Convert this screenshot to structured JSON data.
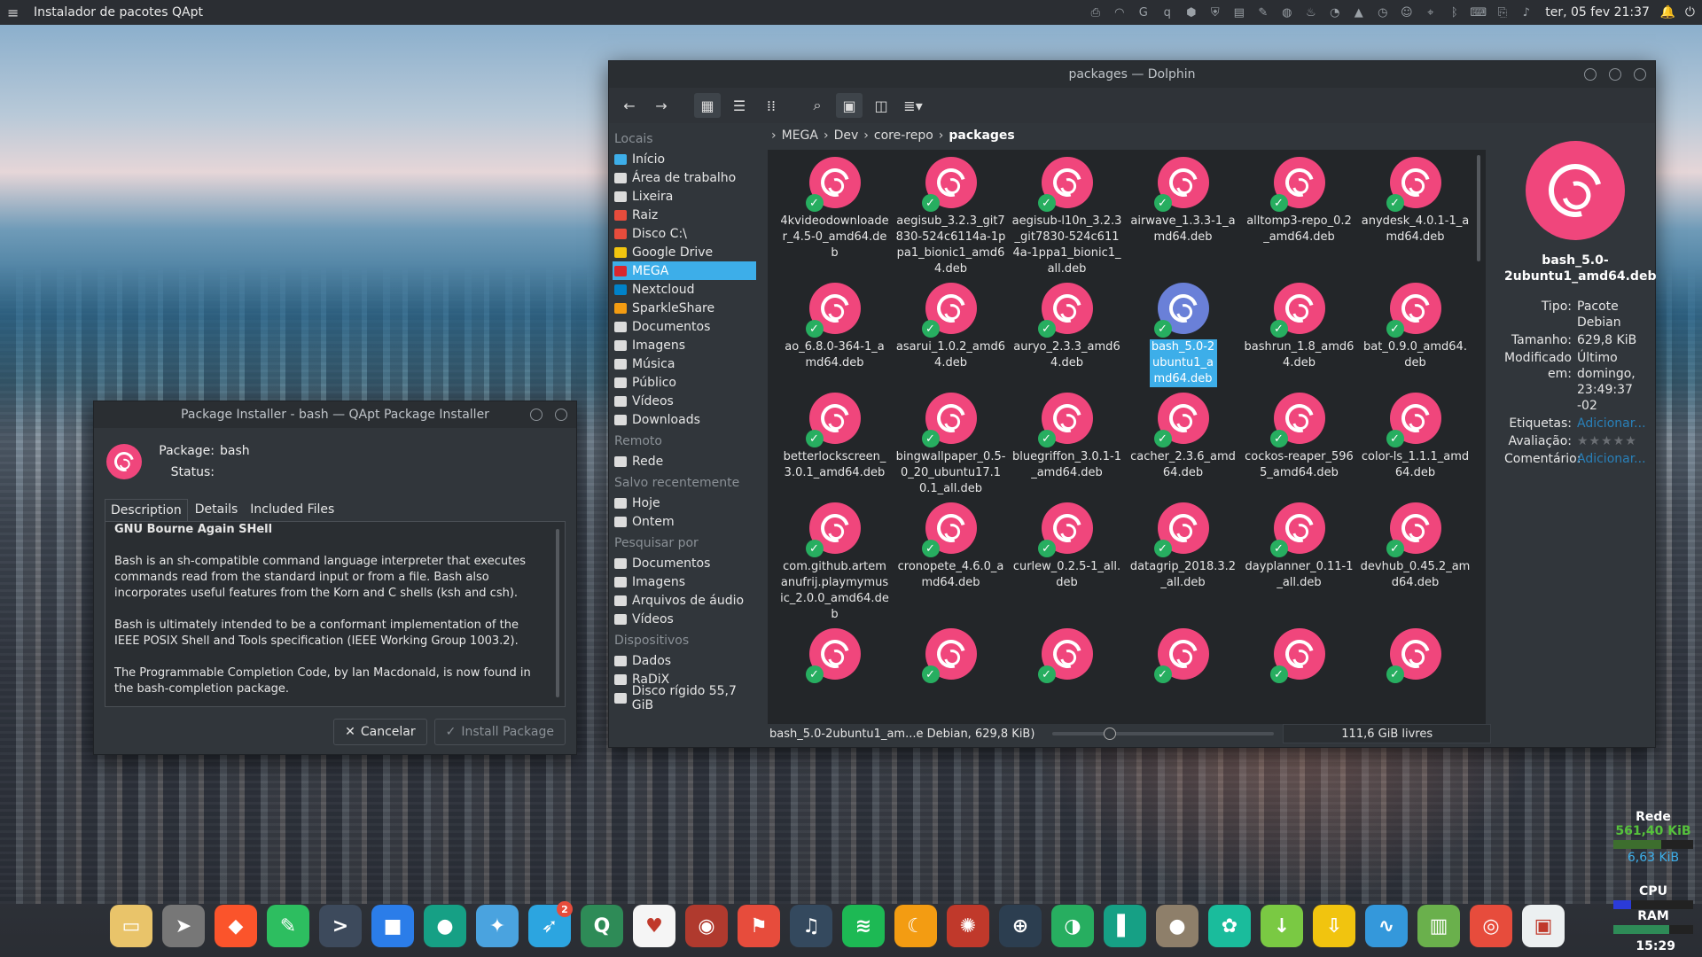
{
  "top_panel": {
    "app_title": "Instalador de pacotes QApt",
    "clock": "ter, 05 fev 21:37",
    "tray_icons": [
      "printer-icon",
      "wifi-icon",
      "g-icon",
      "qb-icon",
      "hex-icon",
      "shield-icon",
      "doc-icon",
      "pen-icon",
      "globe-icon",
      "fire-icon",
      "chat-icon",
      "drive-icon",
      "clock-icon",
      "face-icon",
      "pin-icon",
      "bluetooth-icon",
      "keyboard-icon",
      "clip-icon",
      "volume-icon"
    ]
  },
  "dolphin": {
    "title": "packages — Dolphin",
    "breadcrumb": [
      "MEGA",
      "Dev",
      "core-repo",
      "packages"
    ],
    "places": {
      "locais_label": "Locais",
      "locais": [
        "Início",
        "Área de trabalho",
        "Lixeira",
        "Raiz",
        "Disco C:\\",
        "Google Drive",
        "MEGA",
        "Nextcloud",
        "SparkleShare",
        "Documentos",
        "Imagens",
        "Música",
        "Público",
        "Vídeos",
        "Downloads"
      ],
      "remoto_label": "Remoto",
      "remoto": [
        "Rede"
      ],
      "recente_label": "Salvo recentemente",
      "recente": [
        "Hoje",
        "Ontem"
      ],
      "pesquisar_label": "Pesquisar por",
      "pesquisar": [
        "Documentos",
        "Imagens",
        "Arquivos de áudio",
        "Vídeos"
      ],
      "dispositivos_label": "Dispositivos",
      "dispositivos": [
        "Dados",
        "RaDiX",
        "Disco rígido 55,7 GiB"
      ]
    },
    "files": [
      "4kvideodownloader_4.5-0_amd64.deb",
      "aegisub_3.2.3_git7830-524c6114a-1ppa1_bionic1_amd64.deb",
      "aegisub-l10n_3.2.3_git7830-524c6114a-1ppa1_bionic1_all.deb",
      "airwave_1.3.3-1_amd64.deb",
      "alltomp3-repo_0.2_amd64.deb",
      "anydesk_4.0.1-1_amd64.deb",
      "ao_6.8.0-364-1_amd64.deb",
      "asarui_1.0.2_amd64.deb",
      "auryo_2.3.3_amd64.deb",
      "bash_5.0-2ubuntu1_amd64.deb",
      "bashrun_1.8_amd64.deb",
      "bat_0.9.0_amd64.deb",
      "betterlockscreen_3.0.1_amd64.deb",
      "bingwallpaper_0.5-0_20_ubuntu17.10.1_all.deb",
      "bluegriffon_3.0.1-1_amd64.deb",
      "cacher_2.3.6_amd64.deb",
      "cockos-reaper_5965_amd64.deb",
      "color-ls_1.1.1_amd64.deb",
      "com.github.artemanufrij.playmymusic_2.0.0_amd64.deb",
      "cronopete_4.6.0_amd64.deb",
      "curlew_0.2.5-1_all.deb",
      "datagrip_2018.3.2_all.deb",
      "dayplanner_0.11-1_all.deb",
      "devhub_0.45.2_amd64.deb",
      "",
      "",
      "",
      "",
      "",
      ""
    ],
    "selected_index": 9,
    "status_text": "bash_5.0-2ubuntu1_am...e Debian, 629,8 KiB)",
    "free_space": "111,6 GiB livres",
    "info": {
      "title": "bash_5.0-2ubuntu1_amd64.deb",
      "tipo_k": "Tipo:",
      "tipo_v": "Pacote Debian",
      "tamanho_k": "Tamanho:",
      "tamanho_v": "629,8 KiB",
      "modificado_k": "Modificado em:",
      "modificado_v": "Último domingo, 23:49:37 -02",
      "etiquetas_k": "Etiquetas:",
      "etiquetas_v": "Adicionar...",
      "avaliacao_k": "Avaliação:",
      "avaliacao_v": "★★★★★",
      "comentario_k": "Comentário:",
      "comentario_v": "Adicionar..."
    }
  },
  "qapt": {
    "title": "Package Installer - bash — QApt Package Installer",
    "package_label": "Package:",
    "package_value": "bash",
    "status_label": "Status:",
    "status_value": "",
    "tabs": [
      "Description",
      "Details",
      "Included Files"
    ],
    "desc_title": "GNU Bourne Again SHell",
    "desc_paragraphs": [
      "Bash is an sh-compatible command language interpreter that executes commands read from the standard input or from a file. Bash also incorporates useful features from the Korn and C shells (ksh and csh).",
      "Bash is ultimately intended to be a conformant implementation of the IEEE POSIX Shell and Tools specification (IEEE Working Group 1003.2).",
      "The Programmable Completion Code, by Ian Macdonald, is now found in the bash-completion package."
    ],
    "cancel_label": "Cancelar",
    "install_label": "Install Package"
  },
  "monitors": {
    "rede_label": "Rede",
    "rede_down": "561,40 KiB",
    "rede_up": "6,63 KiB",
    "cpu_label": "CPU",
    "ram_label": "RAM",
    "time": "15:29"
  },
  "dock": {
    "apps": [
      {
        "name": "files-app-icon",
        "color": "#e9c46a",
        "glyph": "▭"
      },
      {
        "name": "launcher-app-icon",
        "color": "#777",
        "glyph": "➤"
      },
      {
        "name": "brave-app-icon",
        "color": "#fb542b",
        "glyph": "◆"
      },
      {
        "name": "evernote-app-icon",
        "color": "#2dbe60",
        "glyph": "✎"
      },
      {
        "name": "terminal-app-icon",
        "color": "#3d4a5c",
        "glyph": ">"
      },
      {
        "name": "cube-app-icon",
        "color": "#2b7de9",
        "glyph": "■"
      },
      {
        "name": "discord-app-icon",
        "color": "#16a085",
        "glyph": "●"
      },
      {
        "name": "bird-app-icon",
        "color": "#4aa3df",
        "glyph": "✦"
      },
      {
        "name": "telegram-app-icon",
        "color": "#2ca5e0",
        "glyph": "➶",
        "badge": "2"
      },
      {
        "name": "qbittorrent-app-icon",
        "color": "#2e8b57",
        "glyph": "Q"
      },
      {
        "name": "cards-app-icon",
        "color": "#f5f5f5",
        "glyph": "♥"
      },
      {
        "name": "mortal-app-icon",
        "color": "#b03a2e",
        "glyph": "◉"
      },
      {
        "name": "flag-app-icon",
        "color": "#e74c3c",
        "glyph": "⚑"
      },
      {
        "name": "headphones-app-icon",
        "color": "#34495e",
        "glyph": "♫"
      },
      {
        "name": "spotify-app-icon",
        "color": "#1db954",
        "glyph": "≋"
      },
      {
        "name": "moon-app-icon",
        "color": "#f39c12",
        "glyph": "☾"
      },
      {
        "name": "network-app-icon",
        "color": "#c0392b",
        "glyph": "✺"
      },
      {
        "name": "sphere-app-icon",
        "color": "#2c3e50",
        "glyph": "⊕"
      },
      {
        "name": "browser-app-icon",
        "color": "#27ae60",
        "glyph": "◑"
      },
      {
        "name": "book-app-icon",
        "color": "#16a085",
        "glyph": "▌"
      },
      {
        "name": "gimp-app-icon",
        "color": "#8e7f6a",
        "glyph": "●"
      },
      {
        "name": "gear-app-icon",
        "color": "#1abc9c",
        "glyph": "✿"
      },
      {
        "name": "download-app-icon",
        "color": "#7ac943",
        "glyph": "↓"
      },
      {
        "name": "install-app-icon",
        "color": "#f1c40f",
        "glyph": "⇩"
      },
      {
        "name": "monitor-app-icon",
        "color": "#3498db",
        "glyph": "∿"
      },
      {
        "name": "trash-app-icon",
        "color": "#6ab04c",
        "glyph": "▥"
      },
      {
        "name": "help-app-icon",
        "color": "#e74c3c",
        "glyph": "◎"
      },
      {
        "name": "bag-app-icon",
        "color": "#ecf0f1",
        "glyph": "▣"
      }
    ]
  }
}
